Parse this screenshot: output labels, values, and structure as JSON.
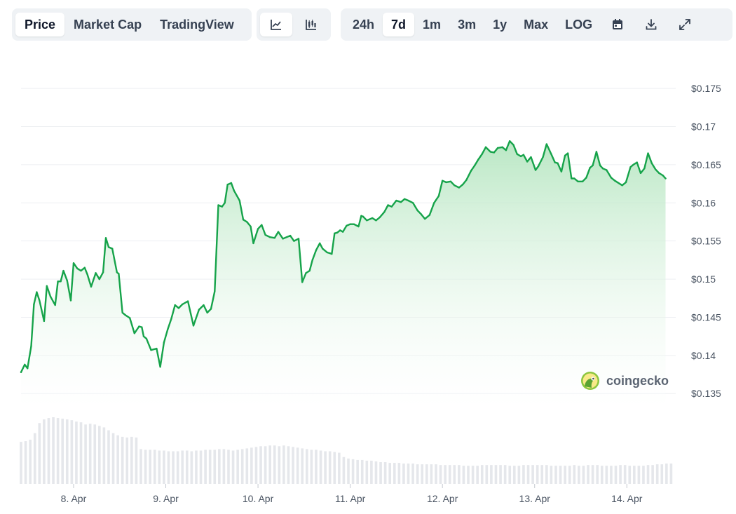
{
  "toolbar": {
    "tabs": [
      {
        "label": "Price",
        "active": true
      },
      {
        "label": "Market Cap",
        "active": false
      },
      {
        "label": "TradingView",
        "active": false
      }
    ],
    "chart_type_buttons": [
      {
        "icon": "line-chart-icon",
        "active": true
      },
      {
        "icon": "candlestick-icon",
        "active": false
      }
    ],
    "ranges": [
      {
        "label": "24h",
        "active": false
      },
      {
        "label": "7d",
        "active": true
      },
      {
        "label": "1m",
        "active": false
      },
      {
        "label": "3m",
        "active": false
      },
      {
        "label": "1y",
        "active": false
      },
      {
        "label": "Max",
        "active": false
      },
      {
        "label": "LOG",
        "active": false
      }
    ],
    "action_icons": [
      "calendar-icon",
      "download-icon",
      "expand-icon"
    ]
  },
  "watermark": {
    "text": "coingecko",
    "icon": "coingecko-logo-icon"
  },
  "colors": {
    "line": "#16a34a",
    "fill_top": "#bfe9c9",
    "volume": "#e5e7eb",
    "grid": "#edeff2",
    "axis_text": "#4b5563"
  },
  "chart_data": {
    "type": "area",
    "title": "",
    "xlabel": "",
    "ylabel": "",
    "ylim": [
      0.133,
      0.1774
    ],
    "yticks": [
      0.135,
      0.14,
      0.145,
      0.15,
      0.155,
      0.16,
      0.165,
      0.17,
      0.175
    ],
    "ytick_labels": [
      "$0.135",
      "$0.14",
      "$0.145",
      "$0.15",
      "$0.155",
      "$0.16",
      "$0.165",
      "$0.17",
      "$0.175"
    ],
    "xlim": [
      7.43,
      14.53
    ],
    "xticks": [
      8,
      9,
      10,
      11,
      12,
      13,
      14
    ],
    "xtick_labels": [
      "8. Apr",
      "9. Apr",
      "10. Apr",
      "11. Apr",
      "12. Apr",
      "13. Apr",
      "14. Apr"
    ],
    "grid": true,
    "legend": "none",
    "series": [
      {
        "x": [
          7.43,
          7.47,
          7.5,
          7.54,
          7.57,
          7.6,
          7.63,
          7.68,
          7.71,
          7.75,
          7.8,
          7.83,
          7.86,
          7.89,
          7.93,
          7.97,
          8.0,
          8.04,
          8.08,
          8.12,
          8.15,
          8.19,
          8.24,
          8.28,
          8.32,
          8.35,
          8.38,
          8.42,
          8.47,
          8.49,
          8.53,
          8.56,
          8.61,
          8.66,
          8.71,
          8.74,
          8.76,
          8.79,
          8.84,
          8.9,
          8.94,
          8.98,
          9.02,
          9.06,
          9.1,
          9.14,
          9.18,
          9.24,
          9.3,
          9.36,
          9.41,
          9.45,
          9.49,
          9.53,
          9.57,
          9.61,
          9.64,
          9.67,
          9.71,
          9.74,
          9.8,
          9.84,
          9.88,
          9.92,
          9.95,
          10.0,
          10.04,
          10.08,
          10.13,
          10.18,
          10.22,
          10.27,
          10.31,
          10.35,
          10.39,
          10.44,
          10.48,
          10.52,
          10.56,
          10.59,
          10.63,
          10.67,
          10.7,
          10.75,
          10.78,
          10.8,
          10.83,
          10.86,
          10.89,
          10.92,
          10.96,
          11.0,
          11.04,
          11.09,
          11.12,
          11.14,
          11.18,
          11.24,
          11.28,
          11.32,
          11.37,
          11.41,
          11.45,
          11.5,
          11.55,
          11.59,
          11.63,
          11.68,
          11.73,
          11.77,
          11.81,
          11.86,
          11.91,
          11.96,
          12.0,
          12.04,
          12.09,
          12.13,
          12.18,
          12.22,
          12.26,
          12.31,
          12.35,
          12.39,
          12.43,
          12.47,
          12.52,
          12.56,
          12.6,
          12.65,
          12.69,
          12.73,
          12.77,
          12.81,
          12.85,
          12.88,
          12.92,
          12.96,
          13.01,
          13.04,
          13.09,
          13.13,
          13.18,
          13.22,
          13.25,
          13.29,
          13.33,
          13.36,
          13.4,
          13.43,
          13.47,
          13.52,
          13.56,
          13.6,
          13.63,
          13.67,
          13.71,
          13.74,
          13.78,
          13.83,
          13.87,
          13.91,
          13.95,
          13.99,
          14.04,
          14.07,
          14.11,
          14.15,
          14.19,
          14.23,
          14.27,
          14.31,
          14.35,
          14.39,
          14.42
        ],
        "y": [
          0.1378,
          0.1388,
          0.1383,
          0.1412,
          0.1467,
          0.1483,
          0.1472,
          0.1445,
          0.1491,
          0.1477,
          0.1466,
          0.1497,
          0.1497,
          0.1511,
          0.1498,
          0.1472,
          0.1521,
          0.1514,
          0.1511,
          0.1515,
          0.1506,
          0.149,
          0.1508,
          0.15,
          0.1509,
          0.1554,
          0.1542,
          0.154,
          0.1509,
          0.1507,
          0.1456,
          0.1453,
          0.1449,
          0.1429,
          0.1438,
          0.1437,
          0.1425,
          0.1422,
          0.1407,
          0.1409,
          0.1385,
          0.1417,
          0.1434,
          0.1448,
          0.1466,
          0.1462,
          0.1467,
          0.1471,
          0.1439,
          0.146,
          0.1466,
          0.1456,
          0.1461,
          0.1484,
          0.1597,
          0.1595,
          0.16,
          0.1624,
          0.1626,
          0.1616,
          0.1603,
          0.1578,
          0.1575,
          0.1569,
          0.1547,
          0.1566,
          0.1571,
          0.1558,
          0.1555,
          0.1554,
          0.1562,
          0.1553,
          0.1555,
          0.1557,
          0.155,
          0.1553,
          0.1496,
          0.1508,
          0.1511,
          0.1525,
          0.1538,
          0.1547,
          0.154,
          0.1535,
          0.1534,
          0.1533,
          0.156,
          0.1561,
          0.1564,
          0.1562,
          0.157,
          0.1572,
          0.1572,
          0.1569,
          0.1583,
          0.1582,
          0.1577,
          0.158,
          0.1577,
          0.1581,
          0.1588,
          0.1597,
          0.1595,
          0.1603,
          0.1601,
          0.1605,
          0.1603,
          0.16,
          0.159,
          0.1585,
          0.1579,
          0.1584,
          0.16,
          0.1609,
          0.1629,
          0.1627,
          0.1628,
          0.1623,
          0.162,
          0.1624,
          0.163,
          0.1642,
          0.1649,
          0.1657,
          0.1664,
          0.1673,
          0.1667,
          0.1666,
          0.1672,
          0.1673,
          0.1669,
          0.1681,
          0.1676,
          0.1664,
          0.1661,
          0.1663,
          0.1654,
          0.166,
          0.1643,
          0.1648,
          0.166,
          0.1677,
          0.1664,
          0.1653,
          0.1652,
          0.1641,
          0.1662,
          0.1665,
          0.1632,
          0.1632,
          0.1628,
          0.1628,
          0.1633,
          0.1646,
          0.1649,
          0.1667,
          0.1649,
          0.1645,
          0.1643,
          0.1633,
          0.1629,
          0.1626,
          0.1623,
          0.1627,
          0.1647,
          0.165,
          0.1653,
          0.1639,
          0.1645,
          0.1665,
          0.1652,
          0.1644,
          0.1639,
          0.1636,
          0.1632
        ]
      }
    ],
    "volume": {
      "x": [
        7.43,
        7.48,
        7.53,
        7.58,
        7.63,
        7.68,
        7.73,
        7.78,
        7.83,
        7.88,
        7.93,
        7.98,
        8.03,
        8.08,
        8.13,
        8.18,
        8.23,
        8.28,
        8.33,
        8.38,
        8.43,
        8.48,
        8.53,
        8.58,
        8.63,
        8.68,
        8.73,
        8.78,
        8.83,
        8.88,
        8.93,
        8.98,
        9.03,
        9.08,
        9.13,
        9.18,
        9.23,
        9.28,
        9.33,
        9.38,
        9.43,
        9.48,
        9.53,
        9.58,
        9.63,
        9.68,
        9.73,
        9.78,
        9.83,
        9.88,
        9.93,
        9.98,
        10.03,
        10.08,
        10.13,
        10.18,
        10.23,
        10.28,
        10.33,
        10.38,
        10.43,
        10.48,
        10.53,
        10.58,
        10.63,
        10.68,
        10.73,
        10.78,
        10.83,
        10.88,
        10.93,
        10.98,
        11.03,
        11.08,
        11.13,
        11.18,
        11.23,
        11.28,
        11.33,
        11.38,
        11.43,
        11.48,
        11.53,
        11.58,
        11.63,
        11.68,
        11.73,
        11.78,
        11.83,
        11.88,
        11.93,
        11.98,
        12.03,
        12.08,
        12.13,
        12.18,
        12.23,
        12.28,
        12.33,
        12.38,
        12.43,
        12.48,
        12.53,
        12.58,
        12.63,
        12.68,
        12.73,
        12.78,
        12.83,
        12.88,
        12.93,
        12.98,
        13.03,
        13.08,
        13.13,
        13.18,
        13.23,
        13.28,
        13.33,
        13.38,
        13.43,
        13.48,
        13.53,
        13.58,
        13.63,
        13.68,
        13.73,
        13.78,
        13.83,
        13.88,
        13.93,
        13.98,
        14.03,
        14.08,
        14.13,
        14.18,
        14.23,
        14.28,
        14.33,
        14.38,
        14.43,
        14.48
      ],
      "v": [
        58,
        59,
        61,
        70,
        84,
        89,
        91,
        92,
        91,
        90,
        89,
        88,
        86,
        85,
        82,
        83,
        82,
        80,
        78,
        74,
        70,
        67,
        65,
        64,
        65,
        64,
        48,
        47,
        47,
        47,
        46,
        46,
        45,
        45,
        45,
        46,
        46,
        45,
        46,
        46,
        47,
        47,
        47,
        48,
        48,
        47,
        46,
        47,
        48,
        49,
        50,
        51,
        52,
        52,
        53,
        53,
        52,
        53,
        52,
        51,
        50,
        49,
        48,
        47,
        47,
        46,
        45,
        45,
        44,
        43,
        37,
        35,
        34,
        33,
        33,
        32,
        32,
        31,
        30,
        30,
        29,
        29,
        29,
        28,
        28,
        28,
        27,
        27,
        27,
        27,
        27,
        26,
        26,
        26,
        26,
        26,
        25,
        25,
        25,
        25,
        26,
        26,
        26,
        26,
        26,
        26,
        25,
        25,
        25,
        26,
        26,
        26,
        26,
        26,
        26,
        25,
        25,
        25,
        25,
        25,
        26,
        25,
        25,
        26,
        26,
        26,
        25,
        25,
        25,
        25,
        26,
        26,
        25,
        25,
        25,
        25,
        26,
        26,
        27,
        27,
        28,
        28,
        28,
        28
      ]
    }
  }
}
